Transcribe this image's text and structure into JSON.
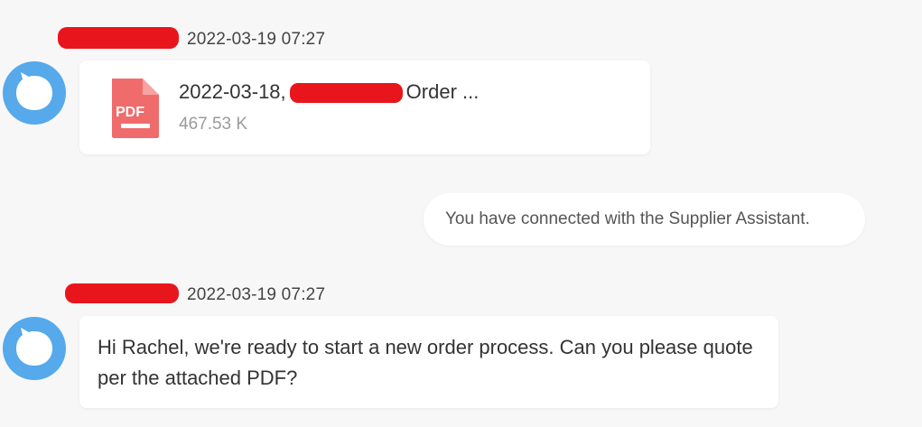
{
  "messages": [
    {
      "timestamp": "2022-03-19 07:27",
      "attachment": {
        "name_prefix": "2022-03-18,",
        "name_suffix": "Order ...",
        "size": "467.53 K",
        "icon": "pdf-icon",
        "icon_label": "PDF"
      }
    },
    {
      "system_notice": "You have connected with the Supplier Assistant."
    },
    {
      "timestamp": "2022-03-19 07:27",
      "text": "Hi Rachel, we're ready to start a new order process. Can you please quote per the attached PDF?"
    }
  ],
  "colors": {
    "avatar": "#56a9ea",
    "pdf_icon": "#f06b6b",
    "redaction": "#e8161c",
    "background": "#f7f7f7"
  }
}
